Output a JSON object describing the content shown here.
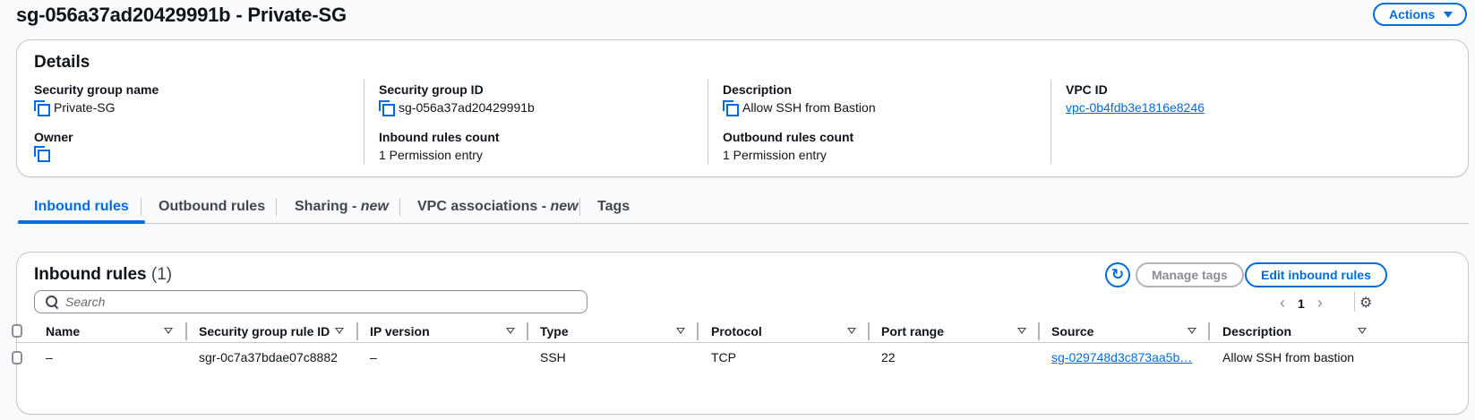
{
  "header": {
    "title": "sg-056a37ad20429991b - Private-SG",
    "actions_label": "Actions"
  },
  "details": {
    "title": "Details",
    "fields": {
      "sg_name_label": "Security group name",
      "sg_name_value": "Private-SG",
      "sg_id_label": "Security group ID",
      "sg_id_value": "sg-056a37ad20429991b",
      "description_label": "Description",
      "description_value": "Allow SSH from Bastion",
      "vpc_id_label": "VPC ID",
      "vpc_id_value": "vpc-0b4fdb3e1816e8246",
      "owner_label": "Owner",
      "owner_value": "",
      "inbound_count_label": "Inbound rules count",
      "inbound_count_value": "1 Permission entry",
      "outbound_count_label": "Outbound rules count",
      "outbound_count_value": "1 Permission entry"
    }
  },
  "tabs": [
    {
      "label": "Inbound rules",
      "suffix": "",
      "active": true
    },
    {
      "label": "Outbound rules",
      "suffix": "",
      "active": false
    },
    {
      "label": "Sharing - ",
      "suffix": "new",
      "active": false
    },
    {
      "label": "VPC associations - ",
      "suffix": "new",
      "active": false
    },
    {
      "label": "Tags",
      "suffix": "",
      "active": false
    }
  ],
  "inbound": {
    "title": "Inbound rules",
    "count": "(1)",
    "manage_tags_label": "Manage tags",
    "edit_label": "Edit inbound rules",
    "search_placeholder": "Search",
    "page": "1",
    "columns": [
      "Name",
      "Security group rule ID",
      "IP version",
      "Type",
      "Protocol",
      "Port range",
      "Source",
      "Description"
    ],
    "rows": [
      {
        "name": "–",
        "rule_id": "sgr-0c7a37bdae07c8882",
        "ip_version": "–",
        "type": "SSH",
        "protocol": "TCP",
        "port_range": "22",
        "source": "sg-029748d3c873aa5b…",
        "description": "Allow SSH from bastion"
      }
    ]
  },
  "colors": {
    "accent": "#006ce0",
    "border": "#c6c6cd",
    "text": "#0f141a"
  }
}
